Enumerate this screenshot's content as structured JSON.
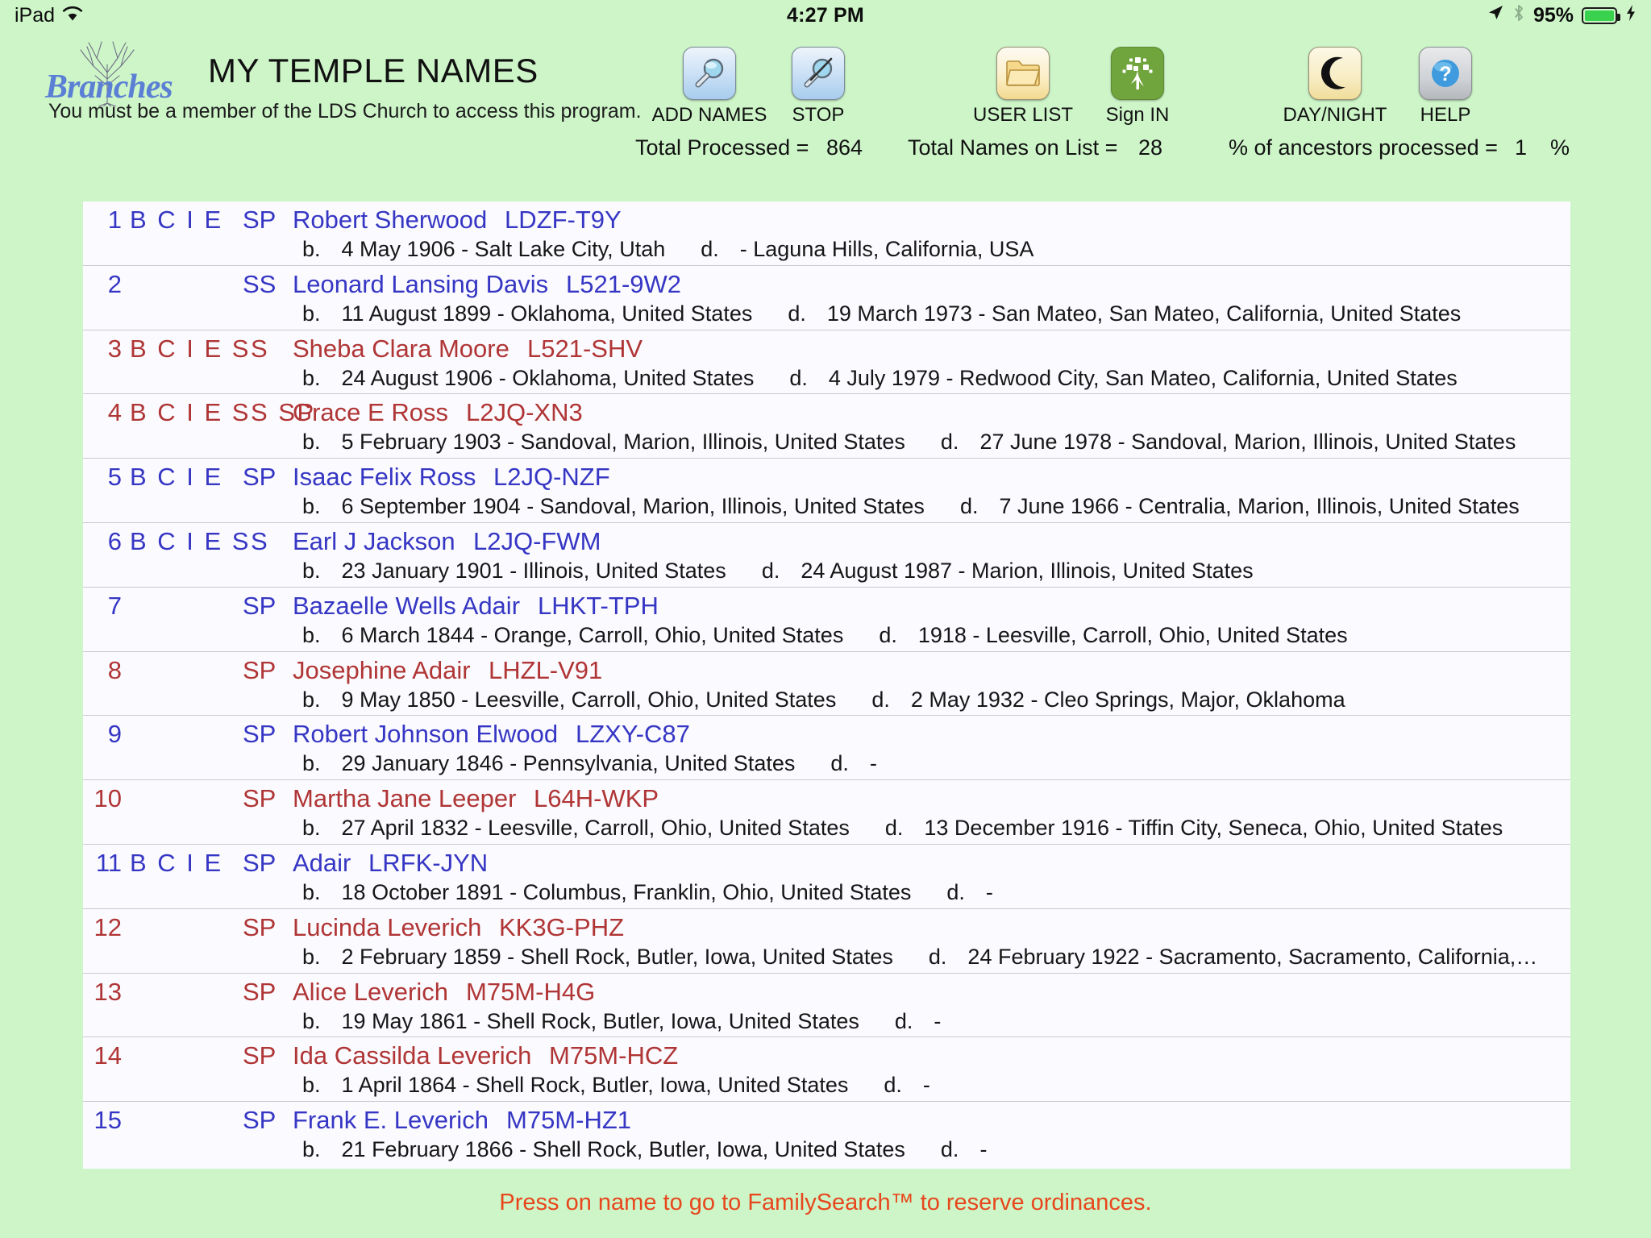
{
  "statusbar": {
    "device": "iPad",
    "wifi_icon": "wifi-icon",
    "time": "4:27 PM",
    "location_icon": "location-arrow-icon",
    "bluetooth_icon": "bluetooth-icon",
    "battery_percent": "95%",
    "charging_icon": "lightning-bolt-icon"
  },
  "header": {
    "brand": "Branches",
    "brand_tree_icon": "tree-icon",
    "title": "MY TEMPLE NAMES",
    "subtitle": "You must be a member of the LDS Church to access this program."
  },
  "toolbar": [
    {
      "id": "add-names",
      "label": "ADD NAMES",
      "icon": "magnifier-icon"
    },
    {
      "id": "stop",
      "label": "STOP",
      "icon": "magnifier-slashed-icon"
    },
    {
      "id": "user-list",
      "label": "USER LIST",
      "icon": "folder-open-icon"
    },
    {
      "id": "sign-in",
      "label": "Sign IN",
      "icon": "family-tree-icon"
    },
    {
      "id": "day-night",
      "label": "DAY/NIGHT",
      "icon": "crescent-moon-icon"
    },
    {
      "id": "help",
      "label": "HELP",
      "icon": "question-mark-circle-icon"
    }
  ],
  "stats": {
    "total_processed_label": "Total Processed =",
    "total_processed_value": "864",
    "total_names_label": "Total Names on List =",
    "total_names_value": "28",
    "percent_label": "% of ancestors processed =",
    "percent_value": "1",
    "percent_sign": "%"
  },
  "colors": {
    "page_background": "#cdf5c8",
    "list_background": "#fafaff",
    "male": "#3636c4",
    "female": "#b03535",
    "footer_text": "#e8461c",
    "sign_in_tile": "#6fa53c"
  },
  "list": [
    {
      "index": "1",
      "ordinances": "B C I E",
      "sealing": "SP",
      "sex": "male",
      "name": "Robert Sherwood",
      "fsid": "LDZF-T9Y",
      "birth_label": "b.",
      "birth": "4 May 1906 - Salt Lake City, Utah",
      "death_label": "d.",
      "death": "- Laguna Hills, California, USA"
    },
    {
      "index": "2",
      "ordinances": "",
      "sealing": "SS",
      "sex": "male",
      "name": "Leonard Lansing Davis",
      "fsid": "L521-9W2",
      "birth_label": "b.",
      "birth": "11 August 1899 - Oklahoma, United States",
      "death_label": "d.",
      "death": "19 March 1973 - San Mateo, San Mateo, California, United States"
    },
    {
      "index": "3",
      "ordinances": "B C I E SS",
      "sealing": "",
      "sex": "female",
      "name": "Sheba Clara Moore",
      "fsid": "L521-SHV",
      "birth_label": "b.",
      "birth": "24 August 1906 - Oklahoma, United States",
      "death_label": "d.",
      "death": "4 July 1979 - Redwood City, San Mateo, California, United States"
    },
    {
      "index": "4",
      "ordinances": "B C I E SS SP",
      "sealing": "",
      "sex": "female",
      "name": "Grace E Ross",
      "fsid": "L2JQ-XN3",
      "birth_label": "b.",
      "birth": "5 February 1903 - Sandoval, Marion, Illinois, United States",
      "death_label": "d.",
      "death": "27 June 1978 - Sandoval, Marion, Illinois, United States"
    },
    {
      "index": "5",
      "ordinances": "B C I E",
      "sealing": "SP",
      "sex": "male",
      "name": "Isaac Felix Ross",
      "fsid": "L2JQ-NZF",
      "birth_label": "b.",
      "birth": "6 September 1904 - Sandoval, Marion, Illinois, United States",
      "death_label": "d.",
      "death": "7 June 1966 - Centralia, Marion, Illinois, United States"
    },
    {
      "index": "6",
      "ordinances": "B C I E SS",
      "sealing": "",
      "sex": "male",
      "name": "Earl J Jackson",
      "fsid": "L2JQ-FWM",
      "birth_label": "b.",
      "birth": "23 January 1901 - Illinois, United States",
      "death_label": "d.",
      "death": "24 August 1987 - Marion, Illinois, United States"
    },
    {
      "index": "7",
      "ordinances": "",
      "sealing": "SP",
      "sex": "male",
      "name": "Bazaelle Wells Adair",
      "fsid": "LHKT-TPH",
      "birth_label": "b.",
      "birth": "6 March 1844 - Orange, Carroll, Ohio, United States",
      "death_label": "d.",
      "death": "1918 - Leesville, Carroll, Ohio, United States"
    },
    {
      "index": "8",
      "ordinances": "",
      "sealing": "SP",
      "sex": "female",
      "name": "Josephine Adair",
      "fsid": "LHZL-V91",
      "birth_label": "b.",
      "birth": "9 May 1850 - Leesville, Carroll, Ohio, United States",
      "death_label": "d.",
      "death": "2 May 1932 - Cleo Springs, Major, Oklahoma"
    },
    {
      "index": "9",
      "ordinances": "",
      "sealing": "SP",
      "sex": "male",
      "name": "Robert Johnson Elwood",
      "fsid": "LZXY-C87",
      "birth_label": "b.",
      "birth": "29 January 1846 - Pennsylvania, United States",
      "death_label": "d.",
      "death": "-"
    },
    {
      "index": "10",
      "ordinances": "",
      "sealing": "SP",
      "sex": "female",
      "name": "Martha Jane Leeper",
      "fsid": "L64H-WKP",
      "birth_label": "b.",
      "birth": "27 April 1832 - Leesville, Carroll, Ohio, United States",
      "death_label": "d.",
      "death": "13 December 1916 - Tiffin City, Seneca, Ohio, United States"
    },
    {
      "index": "11",
      "ordinances": "B C I E",
      "sealing": "SP",
      "sex": "male",
      "name": "Adair",
      "fsid": "LRFK-JYN",
      "birth_label": "b.",
      "birth": "18 October 1891 - Columbus, Franklin, Ohio, United States",
      "death_label": "d.",
      "death": "-"
    },
    {
      "index": "12",
      "ordinances": "",
      "sealing": "SP",
      "sex": "female",
      "name": "Lucinda Leverich",
      "fsid": "KK3G-PHZ",
      "birth_label": "b.",
      "birth": "2 February 1859 - Shell Rock, Butler, Iowa, United States",
      "death_label": "d.",
      "death": "24 February 1922 - Sacramento, Sacramento, California,…"
    },
    {
      "index": "13",
      "ordinances": "",
      "sealing": "SP",
      "sex": "female",
      "name": "Alice Leverich",
      "fsid": "M75M-H4G",
      "birth_label": "b.",
      "birth": "19 May 1861 - Shell Rock, Butler, Iowa, United States",
      "death_label": "d.",
      "death": "-"
    },
    {
      "index": "14",
      "ordinances": "",
      "sealing": "SP",
      "sex": "female",
      "name": "Ida Cassilda Leverich",
      "fsid": "M75M-HCZ",
      "birth_label": "b.",
      "birth": "1 April 1864 - Shell Rock, Butler, Iowa, United States",
      "death_label": "d.",
      "death": "-"
    },
    {
      "index": "15",
      "ordinances": "",
      "sealing": "SP",
      "sex": "male",
      "name": "Frank E. Leverich",
      "fsid": "M75M-HZ1",
      "birth_label": "b.",
      "birth": "21 February 1866 - Shell Rock, Butler, Iowa, United States",
      "death_label": "d.",
      "death": "-"
    }
  ],
  "footer": {
    "note": "Press on name to go to FamilySearch™ to reserve ordinances."
  }
}
